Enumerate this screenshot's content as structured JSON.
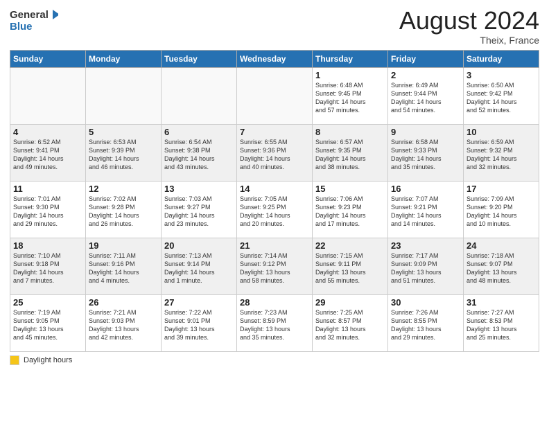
{
  "header": {
    "logo_general": "General",
    "logo_blue": "Blue",
    "month_year": "August 2024",
    "location": "Theix, France"
  },
  "days_of_week": [
    "Sunday",
    "Monday",
    "Tuesday",
    "Wednesday",
    "Thursday",
    "Friday",
    "Saturday"
  ],
  "legend": {
    "label": "Daylight hours"
  },
  "weeks": [
    {
      "days": [
        {
          "num": "",
          "info": ""
        },
        {
          "num": "",
          "info": ""
        },
        {
          "num": "",
          "info": ""
        },
        {
          "num": "",
          "info": ""
        },
        {
          "num": "1",
          "info": "Sunrise: 6:48 AM\nSunset: 9:45 PM\nDaylight: 14 hours\nand 57 minutes."
        },
        {
          "num": "2",
          "info": "Sunrise: 6:49 AM\nSunset: 9:44 PM\nDaylight: 14 hours\nand 54 minutes."
        },
        {
          "num": "3",
          "info": "Sunrise: 6:50 AM\nSunset: 9:42 PM\nDaylight: 14 hours\nand 52 minutes."
        }
      ]
    },
    {
      "days": [
        {
          "num": "4",
          "info": "Sunrise: 6:52 AM\nSunset: 9:41 PM\nDaylight: 14 hours\nand 49 minutes."
        },
        {
          "num": "5",
          "info": "Sunrise: 6:53 AM\nSunset: 9:39 PM\nDaylight: 14 hours\nand 46 minutes."
        },
        {
          "num": "6",
          "info": "Sunrise: 6:54 AM\nSunset: 9:38 PM\nDaylight: 14 hours\nand 43 minutes."
        },
        {
          "num": "7",
          "info": "Sunrise: 6:55 AM\nSunset: 9:36 PM\nDaylight: 14 hours\nand 40 minutes."
        },
        {
          "num": "8",
          "info": "Sunrise: 6:57 AM\nSunset: 9:35 PM\nDaylight: 14 hours\nand 38 minutes."
        },
        {
          "num": "9",
          "info": "Sunrise: 6:58 AM\nSunset: 9:33 PM\nDaylight: 14 hours\nand 35 minutes."
        },
        {
          "num": "10",
          "info": "Sunrise: 6:59 AM\nSunset: 9:32 PM\nDaylight: 14 hours\nand 32 minutes."
        }
      ]
    },
    {
      "days": [
        {
          "num": "11",
          "info": "Sunrise: 7:01 AM\nSunset: 9:30 PM\nDaylight: 14 hours\nand 29 minutes."
        },
        {
          "num": "12",
          "info": "Sunrise: 7:02 AM\nSunset: 9:28 PM\nDaylight: 14 hours\nand 26 minutes."
        },
        {
          "num": "13",
          "info": "Sunrise: 7:03 AM\nSunset: 9:27 PM\nDaylight: 14 hours\nand 23 minutes."
        },
        {
          "num": "14",
          "info": "Sunrise: 7:05 AM\nSunset: 9:25 PM\nDaylight: 14 hours\nand 20 minutes."
        },
        {
          "num": "15",
          "info": "Sunrise: 7:06 AM\nSunset: 9:23 PM\nDaylight: 14 hours\nand 17 minutes."
        },
        {
          "num": "16",
          "info": "Sunrise: 7:07 AM\nSunset: 9:21 PM\nDaylight: 14 hours\nand 14 minutes."
        },
        {
          "num": "17",
          "info": "Sunrise: 7:09 AM\nSunset: 9:20 PM\nDaylight: 14 hours\nand 10 minutes."
        }
      ]
    },
    {
      "days": [
        {
          "num": "18",
          "info": "Sunrise: 7:10 AM\nSunset: 9:18 PM\nDaylight: 14 hours\nand 7 minutes."
        },
        {
          "num": "19",
          "info": "Sunrise: 7:11 AM\nSunset: 9:16 PM\nDaylight: 14 hours\nand 4 minutes."
        },
        {
          "num": "20",
          "info": "Sunrise: 7:13 AM\nSunset: 9:14 PM\nDaylight: 14 hours\nand 1 minute."
        },
        {
          "num": "21",
          "info": "Sunrise: 7:14 AM\nSunset: 9:12 PM\nDaylight: 13 hours\nand 58 minutes."
        },
        {
          "num": "22",
          "info": "Sunrise: 7:15 AM\nSunset: 9:11 PM\nDaylight: 13 hours\nand 55 minutes."
        },
        {
          "num": "23",
          "info": "Sunrise: 7:17 AM\nSunset: 9:09 PM\nDaylight: 13 hours\nand 51 minutes."
        },
        {
          "num": "24",
          "info": "Sunrise: 7:18 AM\nSunset: 9:07 PM\nDaylight: 13 hours\nand 48 minutes."
        }
      ]
    },
    {
      "days": [
        {
          "num": "25",
          "info": "Sunrise: 7:19 AM\nSunset: 9:05 PM\nDaylight: 13 hours\nand 45 minutes."
        },
        {
          "num": "26",
          "info": "Sunrise: 7:21 AM\nSunset: 9:03 PM\nDaylight: 13 hours\nand 42 minutes."
        },
        {
          "num": "27",
          "info": "Sunrise: 7:22 AM\nSunset: 9:01 PM\nDaylight: 13 hours\nand 39 minutes."
        },
        {
          "num": "28",
          "info": "Sunrise: 7:23 AM\nSunset: 8:59 PM\nDaylight: 13 hours\nand 35 minutes."
        },
        {
          "num": "29",
          "info": "Sunrise: 7:25 AM\nSunset: 8:57 PM\nDaylight: 13 hours\nand 32 minutes."
        },
        {
          "num": "30",
          "info": "Sunrise: 7:26 AM\nSunset: 8:55 PM\nDaylight: 13 hours\nand 29 minutes."
        },
        {
          "num": "31",
          "info": "Sunrise: 7:27 AM\nSunset: 8:53 PM\nDaylight: 13 hours\nand 25 minutes."
        }
      ]
    }
  ]
}
